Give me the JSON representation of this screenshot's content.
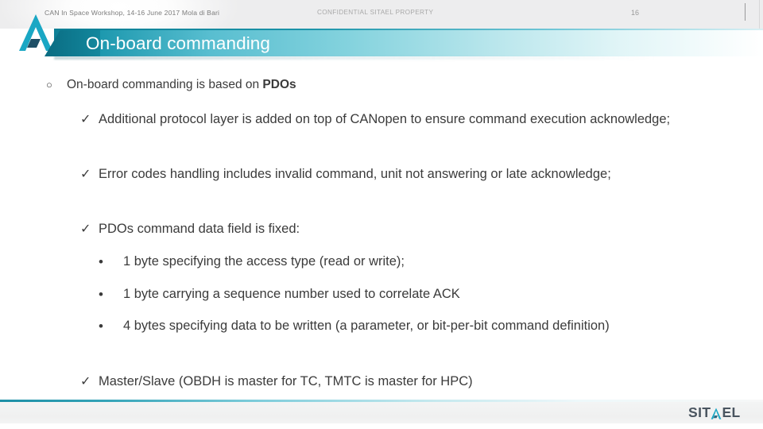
{
  "slide": {
    "title": "On-board commanding",
    "brand_color": "#0f7c92",
    "accent_color": "#35a4b8",
    "text_color": "#3b3b3b"
  },
  "logo": {
    "header_mark": "chevron-a-logo",
    "footer_wordmark_part1": "SIT",
    "footer_wordmark_chevron": "chevron-a-logo",
    "footer_wordmark_part2": "EL"
  },
  "body": {
    "items": [
      {
        "level": 1,
        "marker": "○",
        "text_before_bold": "On-board commanding is based on ",
        "bold": "PDOs",
        "text_after_bold": ""
      },
      {
        "level": 2,
        "marker": "✓",
        "text": "Additional protocol layer is added on top of CANopen to ensure command execution acknowledge;"
      },
      {
        "level": 2,
        "marker": "✓",
        "text": "Error codes handling includes invalid command, unit not answering or late acknowledge;"
      },
      {
        "level": 2,
        "marker": "✓",
        "text": "PDOs command data field is fixed:"
      },
      {
        "level": 3,
        "marker": "•",
        "text": "1 byte specifying the access type (read or write);"
      },
      {
        "level": 3,
        "marker": "•",
        "text": "1 byte carrying a sequence number used to correlate ACK"
      },
      {
        "level": 3,
        "marker": "•",
        "text": "4 bytes specifying data to be written (a parameter, or bit-per-bit command definition)"
      },
      {
        "level": 2,
        "marker": "✓",
        "text": "Master/Slave (OBDH is master for TC, TMTC is master for HPC)"
      }
    ]
  },
  "footer": {
    "left": "CAN In Space Workshop, 14-16 June 2017 Mola di Bari",
    "center": "CONFIDENTIAL SITAEL PROPERTY",
    "page_number": "16"
  }
}
